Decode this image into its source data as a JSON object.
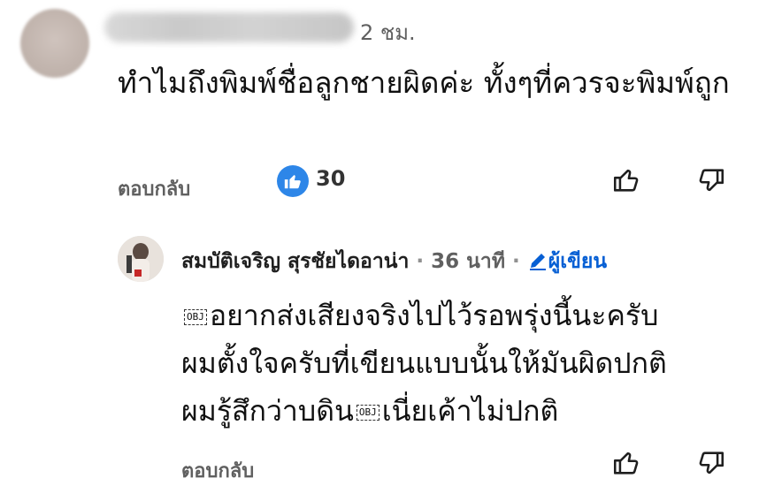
{
  "comment": {
    "time": "2 ชม.",
    "text": "ทำไมถึงพิมพ์ชื่อลูกชายผิดค่ะ ทั้งๆที่ควรจะพิมพ์ถูก",
    "reply_label": "ตอบกลับ",
    "like_count": "30"
  },
  "reply": {
    "author": "สมบัติเจริญ สุรชัยไดอาน่า",
    "separator": "·",
    "time": "36 นาที",
    "author_badge": "ผู้เขียน",
    "obj_label": "OBJ",
    "line1": "อยากส่งเสียงจริงไปไว้รอพรุ่งนี้นะครับ",
    "line2": "ผมตั้งใจครับที่เขียนแบบนั้นให้มันผิดปกติ",
    "line3_a": "ผมรู้สึกว่าบดิน",
    "line3_b": "เนี่ยเค้าไม่ปกติ",
    "reply_label": "ตอบกลับ"
  },
  "colors": {
    "accent_blue": "#2d86e8",
    "link_blue": "#065fd4",
    "meta_gray": "#606060"
  },
  "icons": [
    "like-icon",
    "dislike-icon",
    "pencil-icon"
  ]
}
